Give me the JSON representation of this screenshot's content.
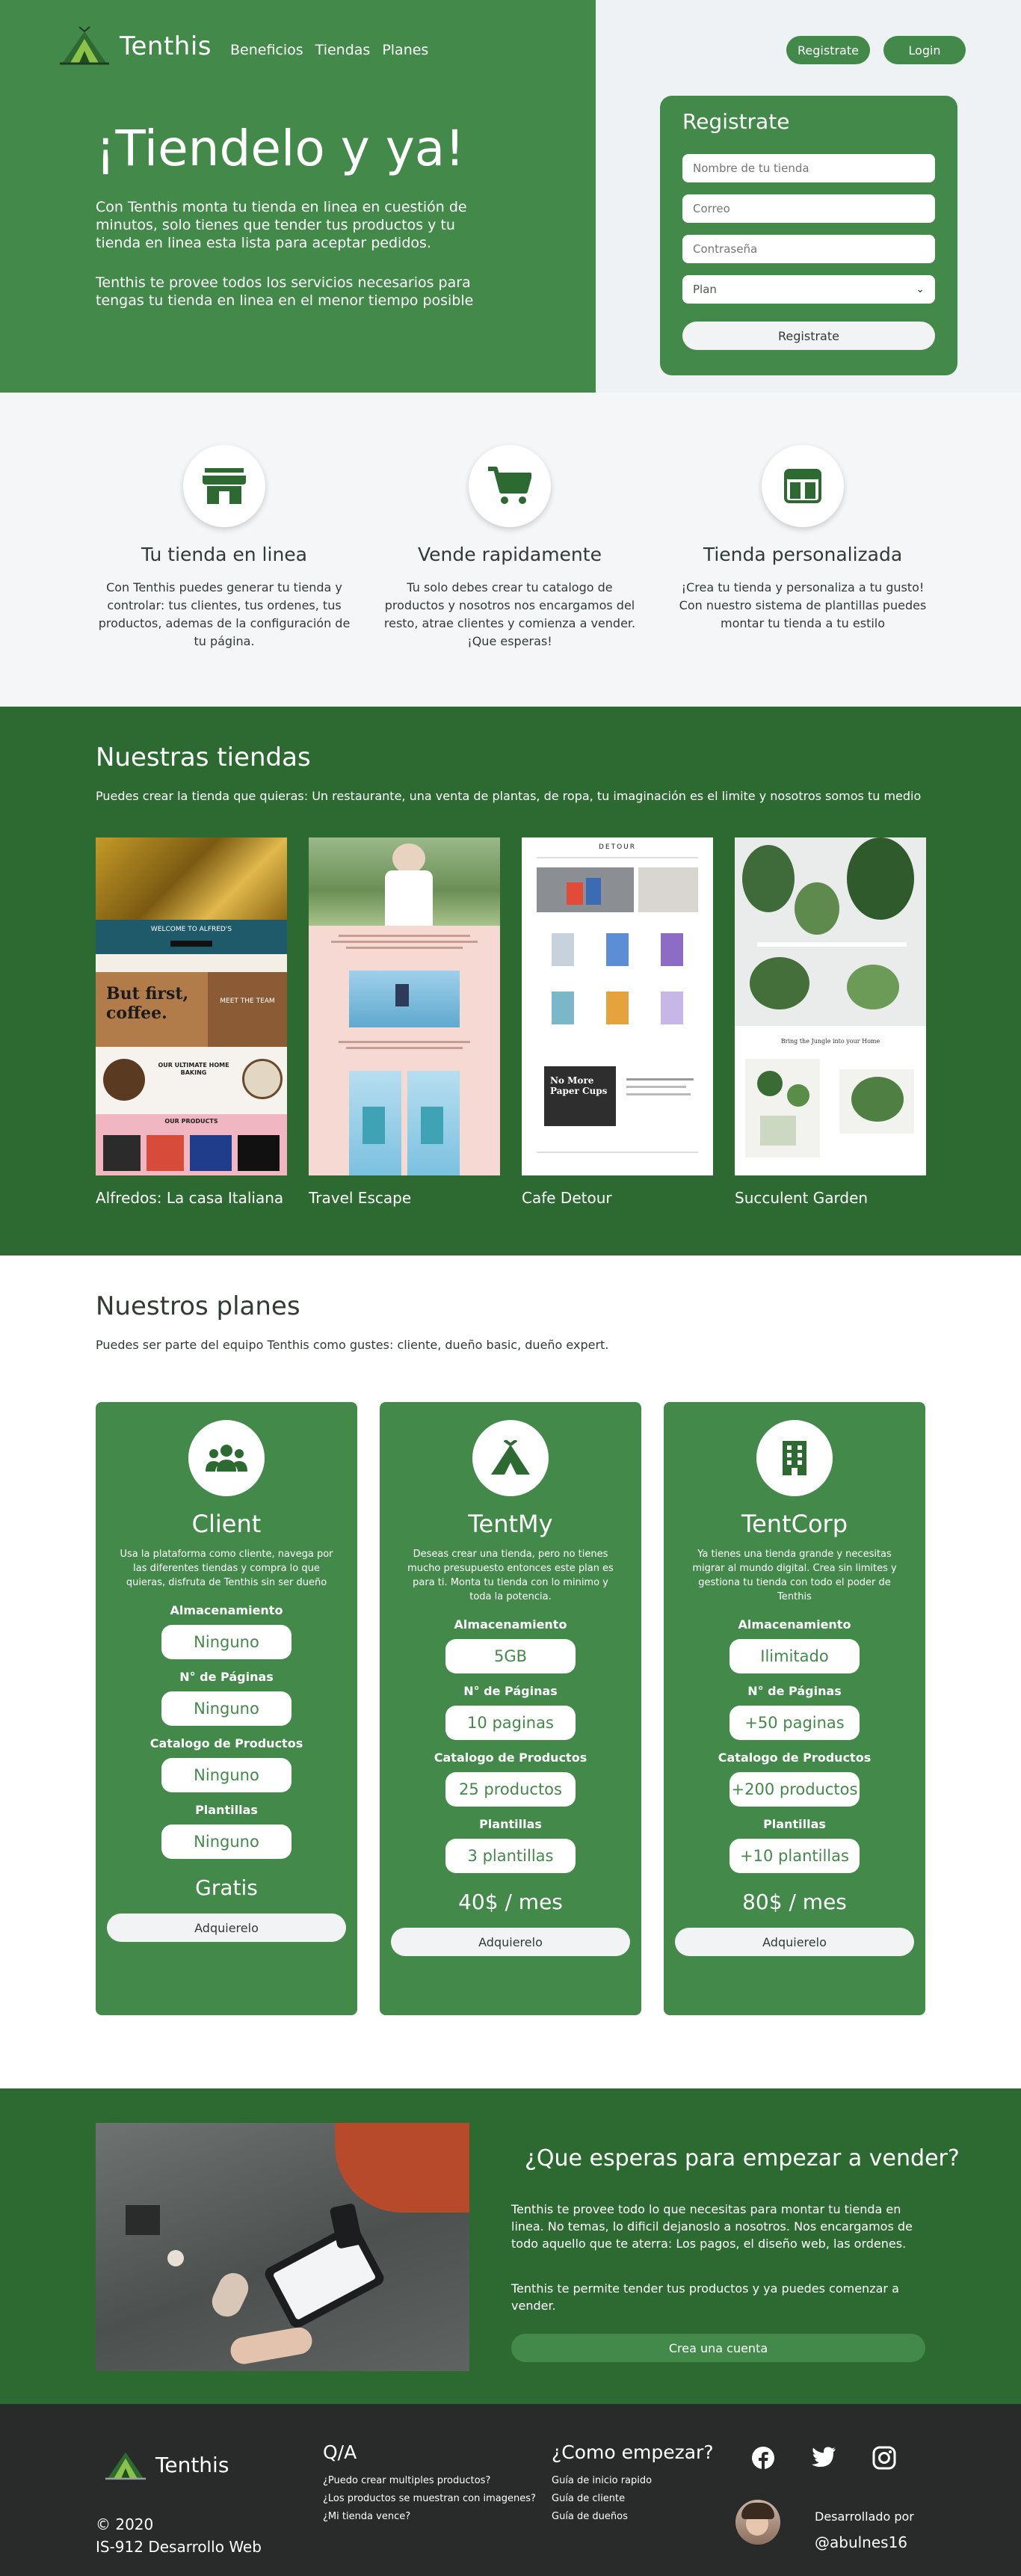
{
  "brand": {
    "name": "Tenthis"
  },
  "nav": {
    "links": [
      "Beneficios",
      "Tiendas",
      "Planes"
    ],
    "register_label": "Registrate",
    "login_label": "Login"
  },
  "hero": {
    "title": "¡Tiendelo y ya!",
    "p1": "Con Tenthis monta tu tienda en linea en cuestión de minutos, solo tienes que tender tus productos y tu tienda en linea esta lista para aceptar pedidos.",
    "p2": "Tenthis te provee todos los servicios necesarios para tengas tu tienda en linea en el menor tiempo posible"
  },
  "register_form": {
    "title": "Registrate",
    "store_placeholder": "Nombre de tu tienda",
    "email_placeholder": "Correo",
    "password_placeholder": "Contraseña",
    "plan_selected": "Plan",
    "submit_label": "Registrate"
  },
  "features": [
    {
      "icon": "store-icon",
      "title": "Tu tienda en linea",
      "text": "Con Tenthis puedes generar tu tienda y controlar: tus clientes, tus ordenes, tus productos, ademas de la configuración de tu página."
    },
    {
      "icon": "shopping-cart-icon",
      "title": "Vende rapidamente",
      "text": "Tu solo debes crear tu catalogo de productos y nosotros nos encargamos del resto, atrae clientes y comienza a vender.¡Que esperas!"
    },
    {
      "icon": "layout-icon",
      "title": "Tienda personalizada",
      "text": "¡Crea tu tienda y personaliza a tu gusto! Con nuestro sistema de plantillas puedes montar tu tienda a tu estilo"
    }
  ],
  "stores": {
    "title": "Nuestras tiendas",
    "subtitle": "Puedes crear la tienda que quieras: Un restaurante, una venta de plantas, de ropa, tu imaginación es el limite y nosotros somos tu medio",
    "items": [
      {
        "name": "Alfredos: La casa Italiana",
        "img_texts": [
          "WELCOME TO ALFRED'S",
          "But first, coffee.",
          "MEET THE TEAM",
          "OUR ULTIMATE HOME BAKING",
          "OUR PRODUCTS"
        ]
      },
      {
        "name": "Travel Escape"
      },
      {
        "name": "Cafe Detour",
        "img_texts": [
          "DETOUR",
          "No More Paper Cups"
        ]
      },
      {
        "name": "Succulent Garden",
        "img_texts": [
          "Bring the Jungle into your Home"
        ]
      }
    ]
  },
  "plans": {
    "title": "Nuestros planes",
    "subtitle": "Puedes ser parte del equipo Tenthis como gustes: cliente, dueño basic, dueño expert.",
    "spec_labels": [
      "Almacenamiento",
      "N° de Páginas",
      "Catalogo de Productos",
      "Plantillas"
    ],
    "button_label": "Adquierelo",
    "items": [
      {
        "icon": "users-icon",
        "name": "Client",
        "desc": "Usa la plataforma como cliente, navega por las diferentes tiendas y compra lo que quieras, disfruta de Tenthis sin ser dueño",
        "specs": [
          "Ninguno",
          "Ninguno",
          "Ninguno",
          "Ninguno"
        ],
        "price": "Gratis"
      },
      {
        "icon": "tent-icon",
        "name": "TentMy",
        "desc": "Deseas crear una tienda, pero no tienes mucho presupuesto entonces este plan es para ti. Monta tu tienda con lo minimo y toda la potencia.",
        "specs": [
          "5GB",
          "10 paginas",
          "25 productos",
          "3 plantillas"
        ],
        "price": "40$ / mes"
      },
      {
        "icon": "building-icon",
        "name": "TentCorp",
        "desc": "Ya tienes una tienda grande y necesitas migrar al mundo digital. Crea sin limites y gestiona tu tienda con todo el poder de Tenthis",
        "specs": [
          "Ilimitado",
          "+50 paginas",
          "+200 productos",
          "+10 plantillas"
        ],
        "price": "80$ / mes"
      }
    ]
  },
  "cta": {
    "title": "¿Que esperas para empezar a vender?",
    "p1": "Tenthis te provee todo lo que necesitas para montar tu tienda en linea. No temas, lo dificil dejanoslo a nosotros. Nos encargamos de todo aquello que te aterra: Los pagos, el diseño web, las ordenes.",
    "p2": "Tenthis te permite tender tus productos y ya puedes comenzar a vender.",
    "button_label": "Crea una cuenta"
  },
  "footer": {
    "brand": "Tenthis",
    "copyright": "© 2020",
    "course": "IS-912 Desarrollo Web",
    "qa_title": "Q/A",
    "qa_links": [
      "¿Puedo crear multiples productos?",
      "¿Los productos se muestran con imagenes?",
      "¿Mi tienda vence?"
    ],
    "start_title": "¿Como empezar?",
    "start_links": [
      "Guía de inicio rapido",
      "Guía de cliente",
      "Guía de dueños"
    ],
    "social": [
      "facebook-icon",
      "twitter-icon",
      "instagram-icon"
    ],
    "dev_label": "Desarrollado por",
    "dev_handle": "@abulnes16"
  },
  "colors": {
    "primary_green": "#43894a",
    "dark_green": "#2d6a31",
    "footer_bg": "#282b29",
    "light_bg": "#eef2f5"
  }
}
